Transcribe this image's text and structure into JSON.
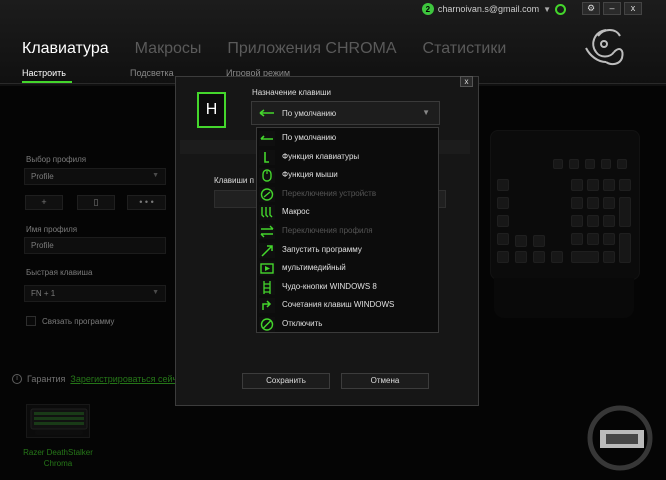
{
  "account": {
    "badge": "2",
    "email": "charnoivan.s@gmail.com"
  },
  "window_controls": {
    "settings": "⚙",
    "minimize": "–",
    "close": "x"
  },
  "nav": {
    "tabs": [
      "Клавиатура",
      "Макросы",
      "Приложения CHROMA",
      "Статистики"
    ]
  },
  "subnav": {
    "items": [
      "Настроить",
      "Подсветка",
      "Игровой режим"
    ]
  },
  "profile": {
    "select_label": "Выбор профиля",
    "select_value": "Profile",
    "add_button": "+",
    "delete_button": "▯",
    "more_button": "• • •",
    "name_label": "Имя профиля",
    "name_value": "Profile",
    "hotkey_label": "Быстрая клавиша",
    "hotkey_value": "FN + 1",
    "link_program_label": "Связать программу"
  },
  "warranty": {
    "label": "Гарантия",
    "link": "Зарегистрироваться сейч"
  },
  "device": {
    "name_line1": "Razer DeathStalker",
    "name_line2": "Chroma"
  },
  "modal": {
    "close": "x",
    "key": "H",
    "assignment_label": "Назначение клавиши",
    "assignment_value": "По умолчанию",
    "bg_label": "Клавиши п",
    "save": "Сохранить",
    "cancel": "Отмена"
  },
  "menu_items": [
    {
      "label": "По умолчанию",
      "icon": "default-icon",
      "disabled": false
    },
    {
      "label": "Функция клавиатуры",
      "icon": "keyboard-function-icon",
      "disabled": false
    },
    {
      "label": "Функция мыши",
      "icon": "mouse-icon",
      "disabled": false
    },
    {
      "label": "Переключения устройств",
      "icon": "device-switch-icon",
      "disabled": true
    },
    {
      "label": "Макрос",
      "icon": "macro-icon",
      "disabled": false
    },
    {
      "label": "Переключения профиля",
      "icon": "profile-switch-icon",
      "disabled": true
    },
    {
      "label": "Запустить программу",
      "icon": "launch-program-icon",
      "disabled": false
    },
    {
      "label": "мультимедийный",
      "icon": "multimedia-icon",
      "disabled": false
    },
    {
      "label": "Чудо-кнопки WINDOWS 8",
      "icon": "windows8-charms-icon",
      "disabled": false
    },
    {
      "label": "Сочетания клавиш WINDOWS",
      "icon": "windows-shortcut-icon",
      "disabled": false
    },
    {
      "label": "Отключить",
      "icon": "disable-icon",
      "disabled": false
    }
  ],
  "colors": {
    "accent": "#44d62c",
    "background": "#0a0a0a",
    "panel": "#161616"
  }
}
